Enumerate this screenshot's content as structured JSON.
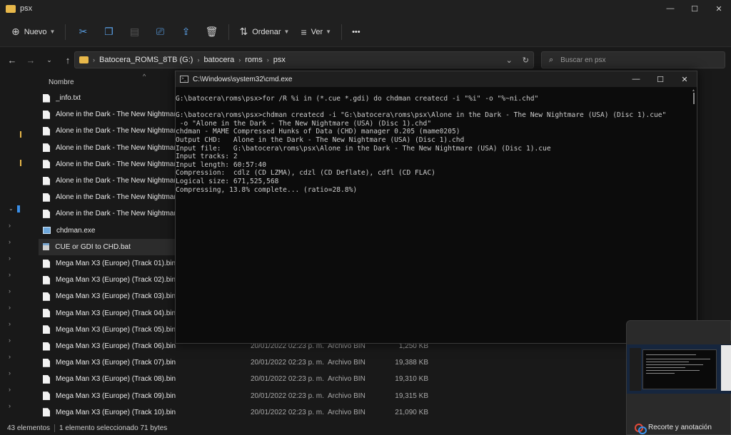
{
  "explorer": {
    "title": "psx",
    "toolbar": {
      "new_label": "Nuevo",
      "sort_label": "Ordenar",
      "view_label": "Ver",
      "more_label": "•••"
    },
    "address": {
      "segments": [
        "Batocera_ROMS_8TB (G:)",
        "batocera",
        "roms",
        "psx"
      ]
    },
    "search": {
      "placeholder": "Buscar en psx"
    },
    "columns": {
      "name": "Nombre"
    },
    "files": [
      {
        "name": "_info.txt",
        "date": "",
        "type": "",
        "size": ""
      },
      {
        "name": "Alone in the Dark - The New Nightmare (USA)",
        "date": "",
        "type": "",
        "size": ""
      },
      {
        "name": "Alone in the Dark - The New Nightmare (USA)",
        "date": "",
        "type": "",
        "size": ""
      },
      {
        "name": "Alone in the Dark - The New Nightmare (USA)",
        "date": "",
        "type": "",
        "size": ""
      },
      {
        "name": "Alone in the Dark - The New Nightmare (USA)",
        "date": "",
        "type": "",
        "size": ""
      },
      {
        "name": "Alone in the Dark - The New Nightmare (USA)",
        "date": "",
        "type": "",
        "size": ""
      },
      {
        "name": "Alone in the Dark - The New Nightmare (USA)",
        "date": "",
        "type": "",
        "size": ""
      },
      {
        "name": "Alone in the Dark - The New Nightmare (USA)",
        "date": "",
        "type": "",
        "size": ""
      },
      {
        "name": "chdman.exe",
        "date": "",
        "type": "",
        "size": ""
      },
      {
        "name": "CUE or GDI to CHD.bat",
        "date": "",
        "type": "",
        "size": ""
      },
      {
        "name": "Mega Man X3 (Europe) (Track 01).bin",
        "date": "",
        "type": "",
        "size": ""
      },
      {
        "name": "Mega Man X3 (Europe) (Track 02).bin",
        "date": "",
        "type": "",
        "size": ""
      },
      {
        "name": "Mega Man X3 (Europe) (Track 03).bin",
        "date": "",
        "type": "",
        "size": ""
      },
      {
        "name": "Mega Man X3 (Europe) (Track 04).bin",
        "date": "",
        "type": "",
        "size": ""
      },
      {
        "name": "Mega Man X3 (Europe) (Track 05).bin",
        "date": "",
        "type": "",
        "size": ""
      },
      {
        "name": "Mega Man X3 (Europe) (Track 06).bin",
        "date": "20/01/2022 02:23 p. m.",
        "type": "Archivo BIN",
        "size": "1,250 KB"
      },
      {
        "name": "Mega Man X3 (Europe) (Track 07).bin",
        "date": "20/01/2022 02:23 p. m.",
        "type": "Archivo BIN",
        "size": "19,388 KB"
      },
      {
        "name": "Mega Man X3 (Europe) (Track 08).bin",
        "date": "20/01/2022 02:23 p. m.",
        "type": "Archivo BIN",
        "size": "19,310 KB"
      },
      {
        "name": "Mega Man X3 (Europe) (Track 09).bin",
        "date": "20/01/2022 02:23 p. m.",
        "type": "Archivo BIN",
        "size": "19,315 KB"
      },
      {
        "name": "Mega Man X3 (Europe) (Track 10).bin",
        "date": "20/01/2022 02:23 p. m.",
        "type": "Archivo BIN",
        "size": "21,090 KB"
      }
    ],
    "status": {
      "count": "43 elementos",
      "selection": "1 elemento seleccionado  71 bytes"
    }
  },
  "cmd": {
    "title": "C:\\Windows\\system32\\cmd.exe",
    "lines": [
      "G:\\batocera\\roms\\psx>for /R %i in (*.cue *.gdi) do chdman createcd -i \"%i\" -o \"%~ni.chd\"",
      "",
      "G:\\batocera\\roms\\psx>chdman createcd -i \"G:\\batocera\\roms\\psx\\Alone in the Dark - The New Nightmare (USA) (Disc 1).cue\"",
      " -o \"Alone in the Dark - The New Nightmare (USA) (Disc 1).chd\"",
      "chdman - MAME Compressed Hunks of Data (CHD) manager 0.205 (mame0205)",
      "Output CHD:   Alone in the Dark - The New Nightmare (USA) (Disc 1).chd",
      "Input file:   G:\\batocera\\roms\\psx\\Alone in the Dark - The New Nightmare (USA) (Disc 1).cue",
      "Input tracks: 2",
      "Input length: 60:57:40",
      "Compression:  cdlz (CD LZMA), cdzl (CD Deflate), cdfl (CD FLAC)",
      "Logical size: 671,525,568",
      "Compressing, 13.8% complete... (ratio=28.8%)"
    ]
  },
  "notification": {
    "label": "Recorte y anotación"
  }
}
